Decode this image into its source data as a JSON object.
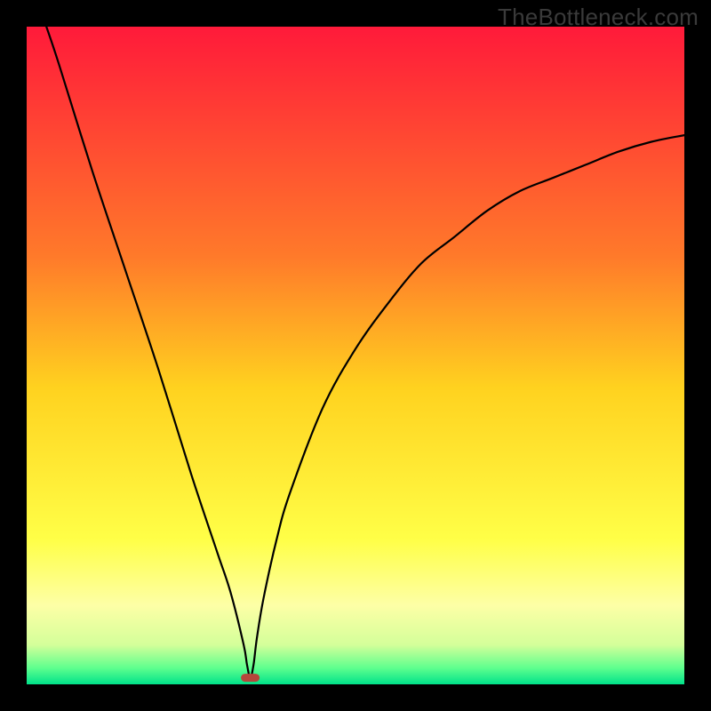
{
  "watermark": "TheBottleneck.com",
  "chart_data": {
    "type": "line",
    "title": "",
    "xlabel": "",
    "ylabel": "",
    "xlim": [
      0,
      100
    ],
    "ylim": [
      0,
      100
    ],
    "grid": false,
    "series": [
      {
        "name": "curve",
        "x": [
          3,
          5,
          10,
          15,
          20,
          25,
          29,
          31,
          33,
          33.5,
          34,
          34.5,
          35,
          36,
          38,
          40,
          45,
          50,
          55,
          60,
          65,
          70,
          75,
          80,
          85,
          90,
          95,
          100
        ],
        "y": [
          100,
          94,
          78,
          63,
          48,
          32,
          20,
          14,
          6,
          3,
          1,
          3,
          7,
          13,
          22,
          29,
          42,
          51,
          58,
          64,
          68,
          72,
          75,
          77,
          79,
          81,
          82.5,
          83.5
        ]
      }
    ],
    "marker": {
      "x": 34,
      "y": 1,
      "shape": "rounded-rect",
      "color": "#b6463b"
    },
    "gradient_stops": [
      {
        "offset": 0.0,
        "color": "#ff1a3a"
      },
      {
        "offset": 0.35,
        "color": "#ff7a2a"
      },
      {
        "offset": 0.55,
        "color": "#ffd21f"
      },
      {
        "offset": 0.78,
        "color": "#ffff47"
      },
      {
        "offset": 0.88,
        "color": "#fdffa6"
      },
      {
        "offset": 0.94,
        "color": "#d4ff9a"
      },
      {
        "offset": 0.975,
        "color": "#5fff8e"
      },
      {
        "offset": 1.0,
        "color": "#00e28a"
      }
    ]
  }
}
